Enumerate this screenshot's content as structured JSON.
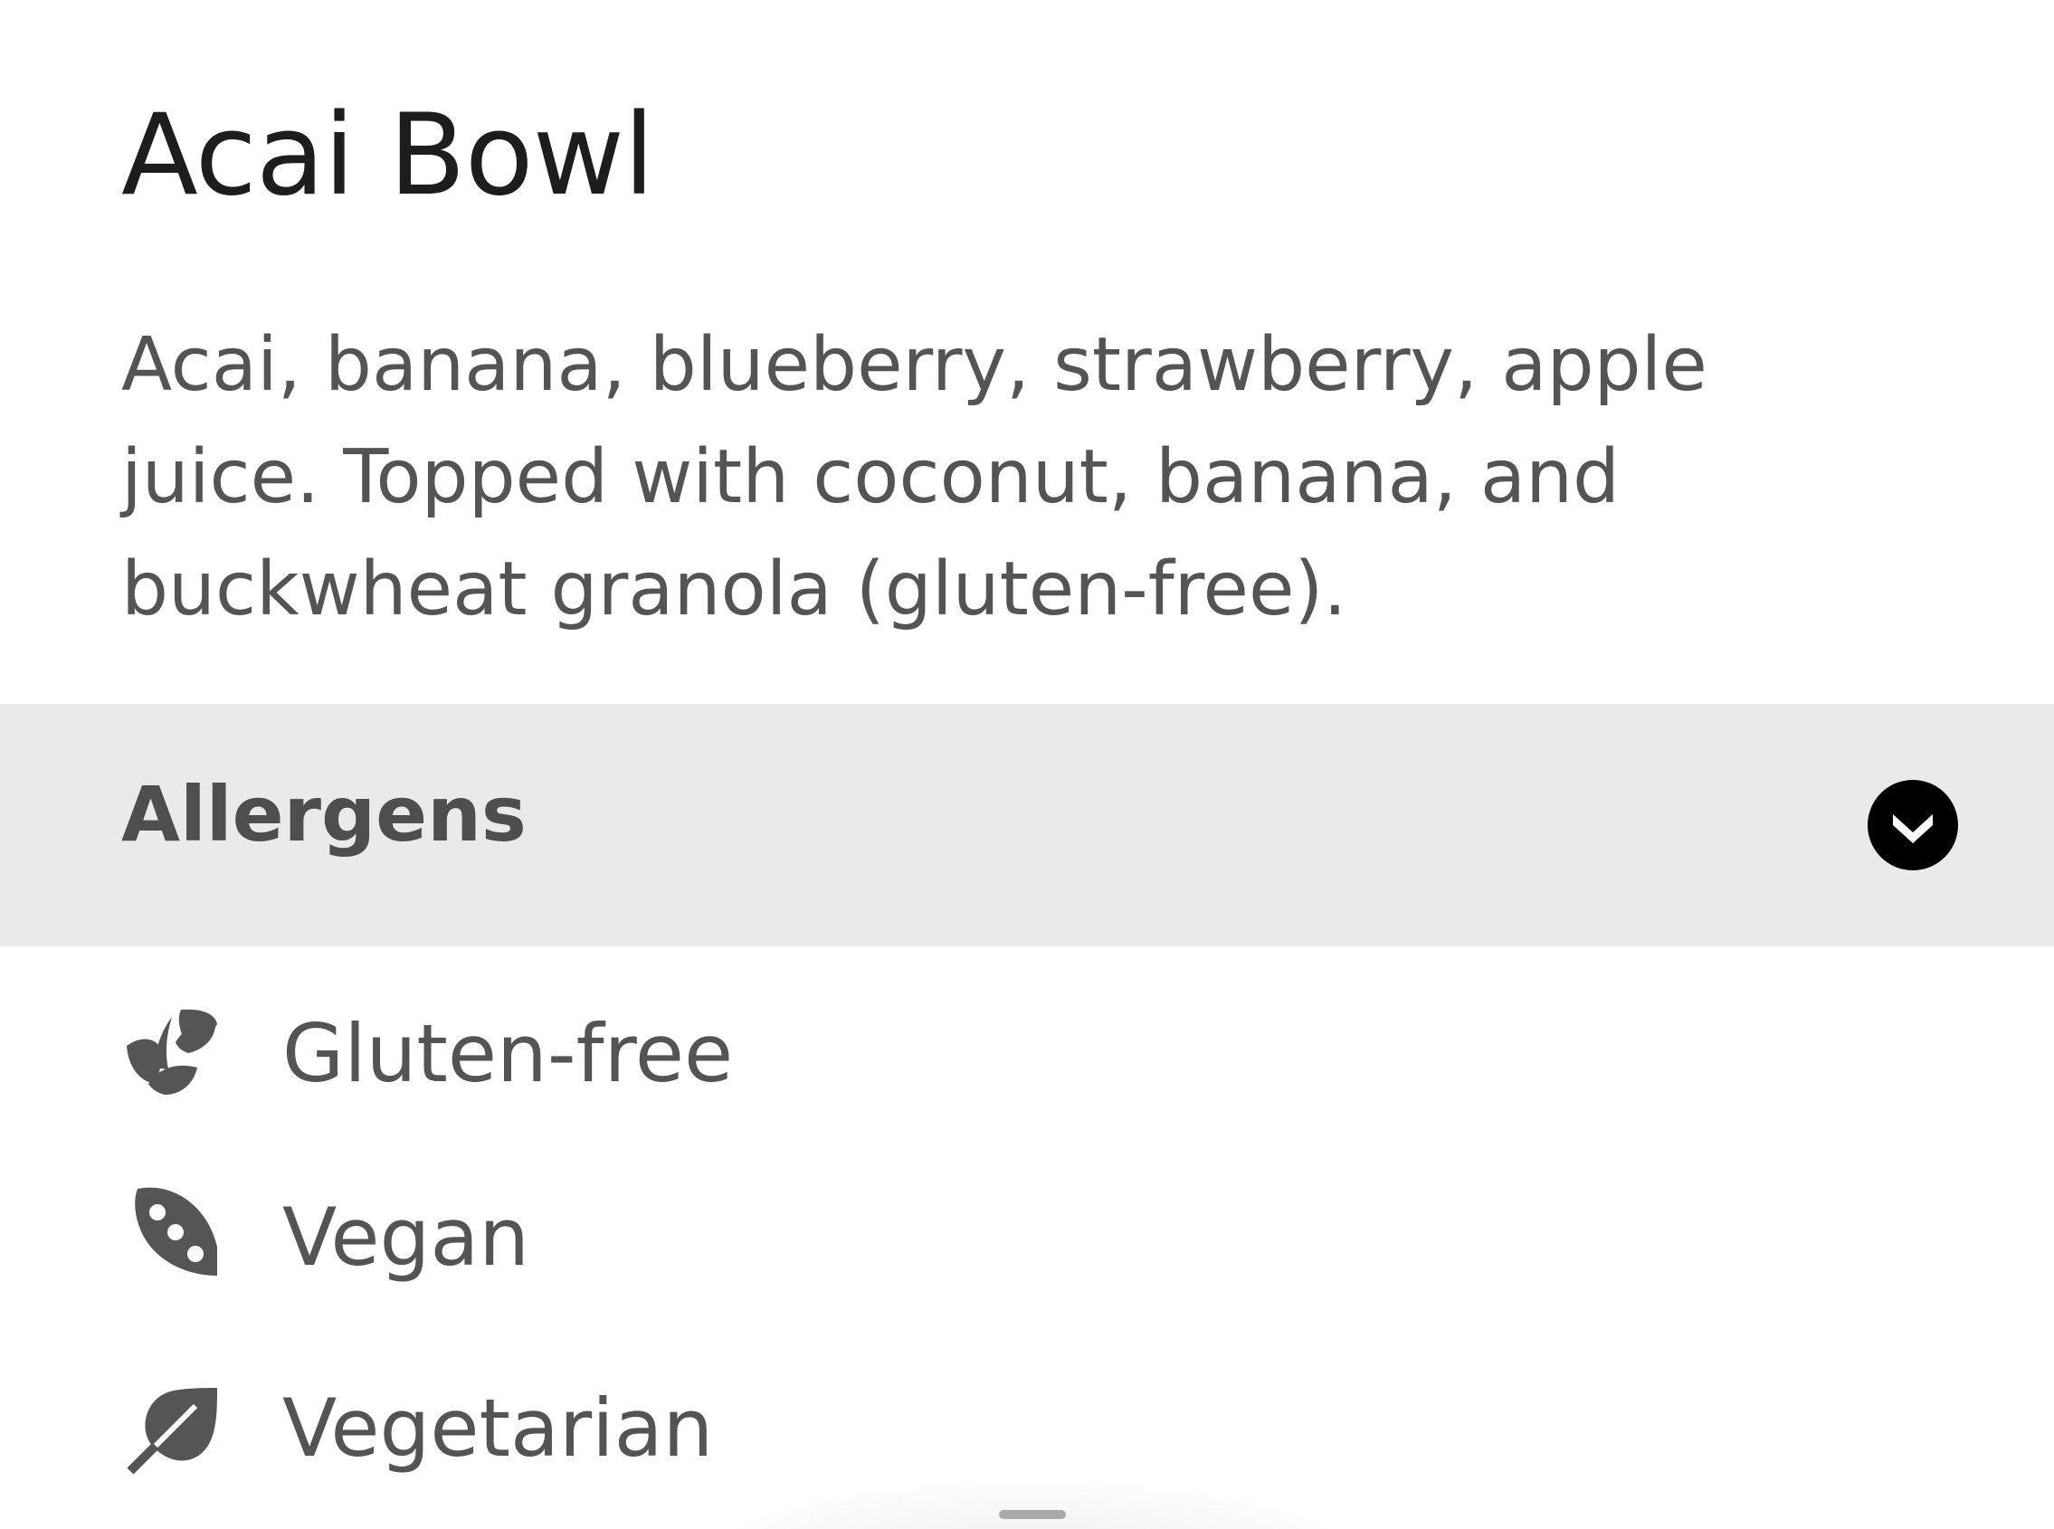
{
  "item": {
    "title": "Acai Bowl",
    "description": "Acai, banana, blueberry, strawberry, apple juice. Topped with coconut, banana, and buckwheat granola (gluten-free)."
  },
  "allergens": {
    "label": "Allergens",
    "toggle_icon": "chevron-down-icon",
    "items": [
      {
        "label": "Gluten-free",
        "icon": "wheat-icon"
      },
      {
        "label": "Vegan",
        "icon": "bean-icon"
      },
      {
        "label": "Vegetarian",
        "icon": "leaf-icon"
      }
    ]
  },
  "colors": {
    "title": "#1d1d1d",
    "text": "#545454",
    "header_bg": "#eaeaea",
    "toggle_bg": "#000000"
  }
}
